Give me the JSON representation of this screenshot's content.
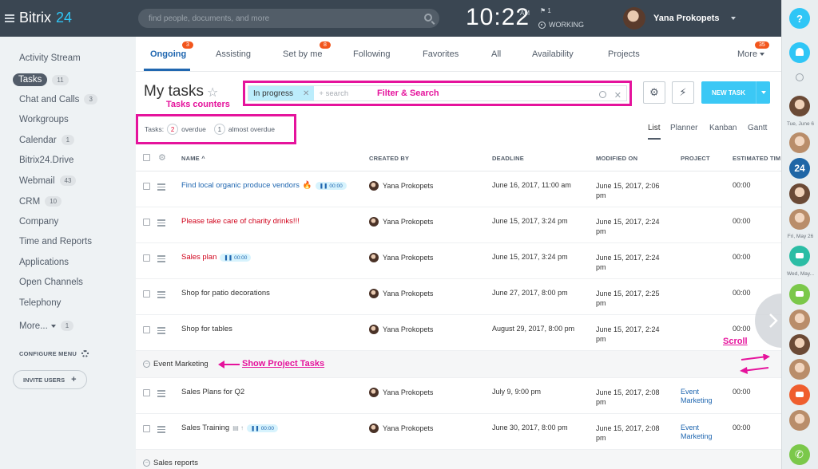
{
  "header": {
    "logo_name": "Bitrix",
    "logo_num": "24",
    "search_placeholder": "find people, documents, and more",
    "clock": "10:22",
    "ampm": "AM",
    "flag_count": "1",
    "status": "WORKING",
    "user_name": "Yana Prokopets"
  },
  "sidebar": {
    "items": [
      {
        "label": "Activity Stream",
        "count": ""
      },
      {
        "label": "Tasks",
        "count": "11"
      },
      {
        "label": "Chat and Calls",
        "count": "3"
      },
      {
        "label": "Workgroups",
        "count": ""
      },
      {
        "label": "Calendar",
        "count": "1"
      },
      {
        "label": "Bitrix24.Drive",
        "count": ""
      },
      {
        "label": "Webmail",
        "count": "43"
      },
      {
        "label": "CRM",
        "count": "10"
      },
      {
        "label": "Company",
        "count": ""
      },
      {
        "label": "Time and Reports",
        "count": ""
      },
      {
        "label": "Applications",
        "count": ""
      },
      {
        "label": "Open Channels",
        "count": ""
      },
      {
        "label": "Telephony",
        "count": ""
      },
      {
        "label": "More...",
        "count": "1"
      }
    ],
    "configure_menu": "CONFIGURE MENU",
    "invite_users": "INVITE USERS"
  },
  "tabs": {
    "items": [
      {
        "label": "Ongoing",
        "badge": "3"
      },
      {
        "label": "Assisting",
        "badge": ""
      },
      {
        "label": "Set by me",
        "badge": "8"
      },
      {
        "label": "Following",
        "badge": ""
      },
      {
        "label": "Favorites",
        "badge": ""
      },
      {
        "label": "All",
        "badge": ""
      },
      {
        "label": "Availability",
        "badge": ""
      },
      {
        "label": "Projects",
        "badge": ""
      },
      {
        "label": "More",
        "badge": "35"
      }
    ]
  },
  "page": {
    "title": "My tasks",
    "filter_chip": "In progress",
    "filter_placeholder": "+ search",
    "new_task": "NEW TASK",
    "counters_label": "Tasks:",
    "overdue_count": "2",
    "overdue_label": "overdue",
    "almost_count": "1",
    "almost_label": "almost overdue",
    "views": [
      "List",
      "Planner",
      "Kanban",
      "Gantt"
    ]
  },
  "annotations": {
    "filter_search": "Filter & Search",
    "tasks_counters": "Tasks counters",
    "show_project_tasks": "Show Project Tasks",
    "scroll": "Scroll"
  },
  "table": {
    "headers": {
      "name": "NAME",
      "created_by": "CREATED BY",
      "deadline": "DEADLINE",
      "modified_on": "MODIFIED ON",
      "project": "PROJECT",
      "estimated": "ESTIMATED TIM"
    },
    "rows": [
      {
        "name": "Find local organic produce vendors",
        "timer": "00:00",
        "creator": "Yana Prokopets",
        "deadline": "June 16, 2017, 11:00 am",
        "modified": "June 15, 2017, 2:06 pm",
        "project": "",
        "est": "00:00"
      },
      {
        "name": "Please take care of charity drinks!!!",
        "timer": "",
        "creator": "Yana Prokopets",
        "deadline": "June 15, 2017, 3:24 pm",
        "modified": "June 15, 2017, 2:24 pm",
        "project": "",
        "est": "00:00"
      },
      {
        "name": "Sales plan",
        "timer": "00:00",
        "creator": "Yana Prokopets",
        "deadline": "June 15, 2017, 3:24 pm",
        "modified": "June 15, 2017, 2:24 pm",
        "project": "",
        "est": "00:00"
      },
      {
        "name": "Shop for patio decorations",
        "timer": "",
        "creator": "Yana Prokopets",
        "deadline": "June 27, 2017, 8:00 pm",
        "modified": "June 15, 2017, 2:25 pm",
        "project": "",
        "est": "00:00"
      },
      {
        "name": "Shop for tables",
        "timer": "",
        "creator": "Yana Prokopets",
        "deadline": "August 29, 2017, 8:00 pm",
        "modified": "June 15, 2017, 2:24 pm",
        "project": "",
        "est": "00:00"
      }
    ],
    "group1": "Event Marketing",
    "group1_rows": [
      {
        "name": "Sales Plans for Q2",
        "timer": "",
        "creator": "Yana Prokopets",
        "deadline": "July 9, 9:00 pm",
        "modified": "June 15, 2017, 2:08 pm",
        "project": "Event Marketing",
        "est": "00:00"
      },
      {
        "name": "Sales Training",
        "timer": "00:00",
        "creator": "Yana Prokopets",
        "deadline": "June 30, 2017, 8:00 pm",
        "modified": "June 15, 2017, 2:08 pm",
        "project": "Event Marketing",
        "est": "00:00"
      }
    ],
    "group2": "Sales reports"
  },
  "rail": {
    "help": "?",
    "date1": "Tue, June 6",
    "date2": "Fri, May 26",
    "date3": "Wed, May..."
  },
  "colors": {
    "accent": "#2067b0",
    "annotation": "#e5139c",
    "new_task": "#3bc8f5",
    "topbar": "#3a4652"
  }
}
